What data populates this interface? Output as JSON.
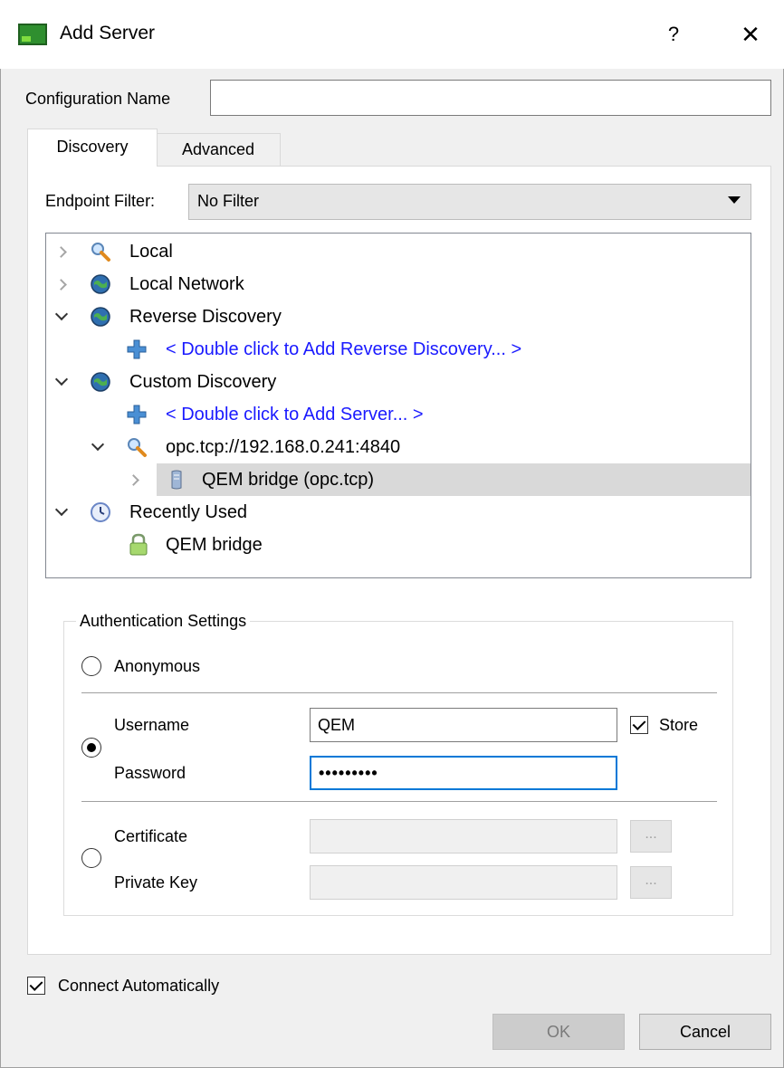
{
  "window": {
    "title": "Add Server",
    "help_glyph": "?",
    "close_glyph": "✕"
  },
  "config": {
    "label": "Configuration Name",
    "value": ""
  },
  "tabs": [
    {
      "label": "Discovery",
      "active": true
    },
    {
      "label": "Advanced",
      "active": false
    }
  ],
  "filter": {
    "label": "Endpoint Filter:",
    "value": "No Filter"
  },
  "tree": {
    "local": "Local",
    "local_network": "Local Network",
    "reverse_discovery": "Reverse Discovery",
    "add_reverse": "< Double click to Add Reverse Discovery... >",
    "custom_discovery": "Custom Discovery",
    "add_server": "< Double click to Add Server... >",
    "endpoint_url": "opc.tcp://192.168.0.241:4840",
    "server_item": "QEM bridge (opc.tcp)",
    "recently_used": "Recently Used",
    "recent_item": "QEM bridge"
  },
  "auth": {
    "title": "Authentication Settings",
    "anonymous": "Anonymous",
    "username_label": "Username",
    "username_value": "QEM",
    "store_label": "Store",
    "password_label": "Password",
    "password_value": "•••••••••",
    "certificate_label": "Certificate",
    "private_key_label": "Private Key",
    "browse_glyph": "..."
  },
  "connect_auto": "Connect Automatically",
  "buttons": {
    "ok": "OK",
    "cancel": "Cancel"
  },
  "colors": {
    "link": "#1a1aff",
    "focus": "#0078d7"
  }
}
